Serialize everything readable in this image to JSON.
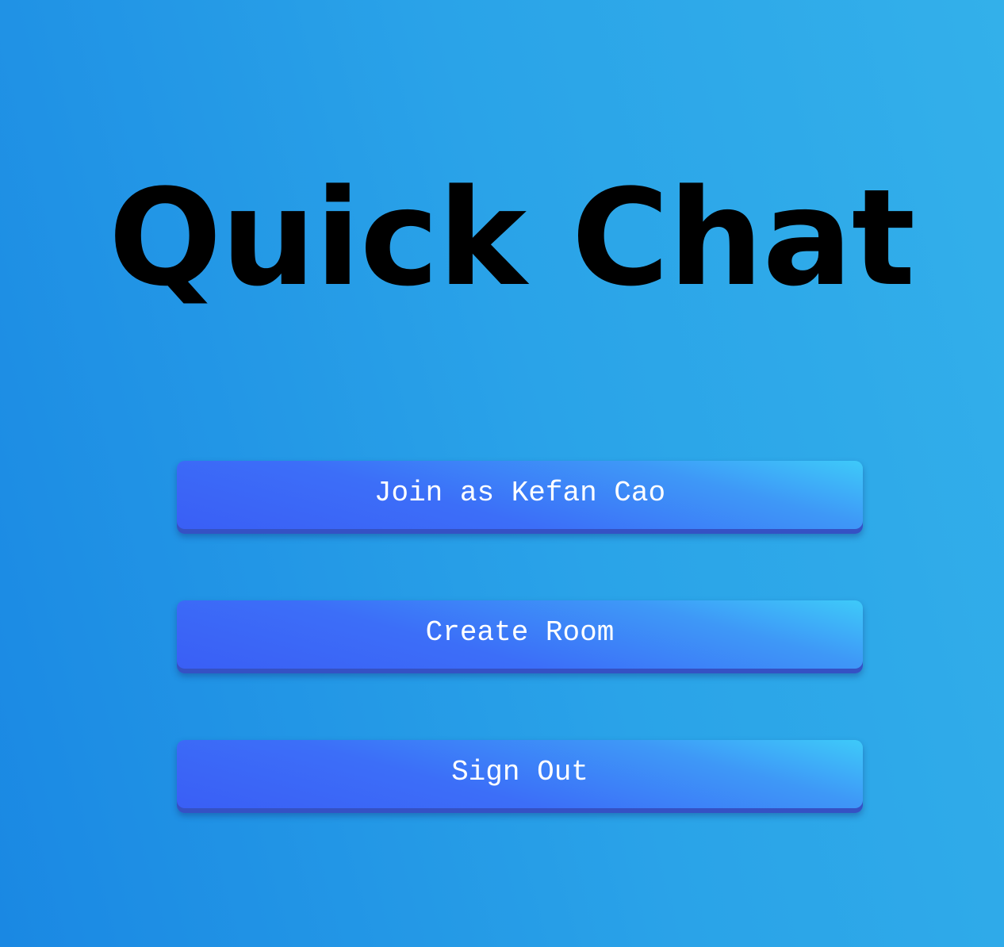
{
  "app": {
    "title": "Quick Chat"
  },
  "menu": {
    "join_label": "Join as Kefan Cao",
    "create_room_label": "Create Room",
    "sign_out_label": "Sign Out"
  },
  "colors": {
    "background_start": "#1a88e3",
    "background_end": "#33b0ea",
    "button_start": "#3a5ef5",
    "button_end": "#3ecaf9",
    "button_text": "#ffffff",
    "title_text": "#000000"
  }
}
